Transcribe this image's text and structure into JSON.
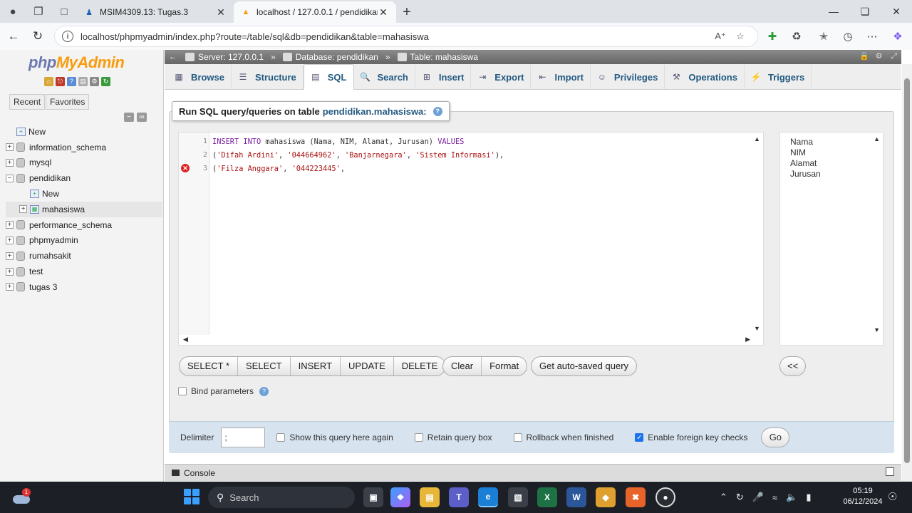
{
  "browser": {
    "tabs": [
      {
        "title": "MSIM4309.13: Tugas.3",
        "active": false
      },
      {
        "title": "localhost / 127.0.0.1 / pendidikan",
        "active": true
      }
    ],
    "url": "localhost/phpmyadmin/index.php?route=/table/sql&db=pendidikan&table=mahasiswa"
  },
  "left": {
    "logo_php": "php",
    "logo_admin": "MyAdmin",
    "recent_tab": "Recent",
    "favorites_tab": "Favorites",
    "tree": [
      {
        "label": "New",
        "level": 0,
        "type": "new"
      },
      {
        "label": "information_schema",
        "level": 0,
        "type": "db"
      },
      {
        "label": "mysql",
        "level": 0,
        "type": "db"
      },
      {
        "label": "pendidikan",
        "level": 0,
        "type": "db-open"
      },
      {
        "label": "New",
        "level": 1,
        "type": "new"
      },
      {
        "label": "mahasiswa",
        "level": 1,
        "type": "table"
      },
      {
        "label": "performance_schema",
        "level": 0,
        "type": "db"
      },
      {
        "label": "phpmyadmin",
        "level": 0,
        "type": "db"
      },
      {
        "label": "rumahsakit",
        "level": 0,
        "type": "db"
      },
      {
        "label": "test",
        "level": 0,
        "type": "db"
      },
      {
        "label": "tugas 3",
        "level": 0,
        "type": "db"
      }
    ]
  },
  "breadcrumb": {
    "server": "Server: 127.0.0.1",
    "database": "Database: pendidikan",
    "table": "Table: mahasiswa"
  },
  "main_tabs": [
    {
      "label": "Browse",
      "icon": "browse-icon",
      "active": false
    },
    {
      "label": "Structure",
      "icon": "structure-icon",
      "active": false
    },
    {
      "label": "SQL",
      "icon": "sql-icon",
      "active": true
    },
    {
      "label": "Search",
      "icon": "search-icon",
      "active": false
    },
    {
      "label": "Insert",
      "icon": "insert-icon",
      "active": false
    },
    {
      "label": "Export",
      "icon": "export-icon",
      "active": false
    },
    {
      "label": "Import",
      "icon": "import-icon",
      "active": false
    },
    {
      "label": "Privileges",
      "icon": "privileges-icon",
      "active": false
    },
    {
      "label": "Operations",
      "icon": "operations-icon",
      "active": false
    },
    {
      "label": "Triggers",
      "icon": "triggers-icon",
      "active": false
    }
  ],
  "sql_panel": {
    "legend": "Run SQL query/queries on table",
    "legend_table": "pendidikan.mahasiswa:",
    "lines": [
      {
        "num": "1",
        "error": false
      },
      {
        "num": "2",
        "error": false
      },
      {
        "num": "3",
        "error": true
      }
    ],
    "code": {
      "l1_kw1": "INSERT INTO",
      "l1_rest": " mahasiswa (Nama, NIM, Alamat, Jurusan) ",
      "l1_kw2": "VALUES",
      "l2_a": "(",
      "l2_s1": "'Difah Ardini'",
      "l2_b": ", ",
      "l2_s2": "'044664962'",
      "l2_c": ", ",
      "l2_s3": "'Banjarnegara'",
      "l2_d": ", ",
      "l2_s4": "'Sistem Informasi'",
      "l2_e": "),",
      "l3_a": "(",
      "l3_s1": "'Filza Anggara'",
      "l3_b": ", ",
      "l3_s2": "'044223445'",
      "l3_c": ","
    },
    "columns": [
      "Nama",
      "NIM",
      "Alamat",
      "Jurusan"
    ],
    "query_buttons": [
      "SELECT *",
      "SELECT",
      "INSERT",
      "UPDATE",
      "DELETE"
    ],
    "clear_label": "Clear",
    "format_label": "Format",
    "autosaved_label": "Get auto-saved query",
    "collapse_label": "<<",
    "bind_params_label": "Bind parameters"
  },
  "footer": {
    "delimiter_label": "Delimiter",
    "delimiter_value": ";",
    "show_again_label": "Show this query here again",
    "retain_label": "Retain query box",
    "rollback_label": "Rollback when finished",
    "fk_checks_label": "Enable foreign key checks",
    "fk_checks_checked": true,
    "go_label": "Go"
  },
  "console_label": "Console",
  "taskbar": {
    "search_placeholder": "Search",
    "time": "05:19",
    "date": "06/12/2024",
    "weather_badge": "1"
  },
  "colors": {
    "accent": "#235a81",
    "logo_blue": "#6c78af",
    "logo_orange": "#f89c0e"
  }
}
